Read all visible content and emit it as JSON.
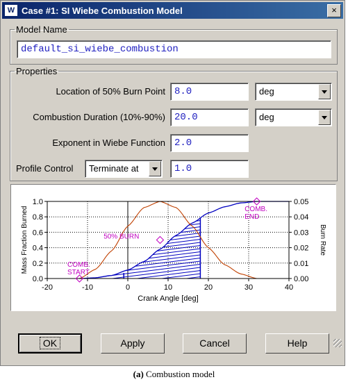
{
  "window": {
    "app_icon_text": "W",
    "title": "Case #1: SI Wiebe Combustion Model",
    "close_label": "×"
  },
  "model_name": {
    "legend": "Model Name",
    "value": "default_si_wiebe_combustion"
  },
  "properties": {
    "legend": "Properties",
    "burn_point": {
      "label": "Location of 50% Burn Point",
      "value": "8.0",
      "unit": "deg"
    },
    "duration": {
      "label": "Combustion Duration (10%-90%)",
      "value": "20.0",
      "unit": "deg"
    },
    "exponent": {
      "label": "Exponent in Wiebe Function",
      "value": "2.0"
    },
    "profile": {
      "label": "Profile Control",
      "mode": "Terminate at",
      "value": "1.0"
    }
  },
  "chart_data": {
    "type": "line",
    "xlabel": "Crank Angle  [deg]",
    "ylabel_left": "Mass Fraction Burned",
    "ylabel_right": "Burn Rate",
    "xlim": [
      -20,
      40
    ],
    "ylim_left": [
      0,
      1.0
    ],
    "ylim_right": [
      0,
      0.05
    ],
    "x_ticks": [
      "-20",
      "-10",
      "0",
      "10",
      "20",
      "30",
      "40"
    ],
    "y_left_ticks": [
      "0.0",
      "0.2",
      "0.4",
      "0.6",
      "0.8",
      "1.0"
    ],
    "y_right_ticks": [
      "0.00",
      "0.01",
      "0.02",
      "0.03",
      "0.04",
      "0.05"
    ],
    "grid": true,
    "series": [
      {
        "values": [
          [
            -12,
            0.0
          ],
          [
            -8,
            0.01
          ],
          [
            -4,
            0.04
          ],
          [
            0,
            0.11
          ],
          [
            4,
            0.22
          ],
          [
            8,
            0.38
          ],
          [
            12,
            0.56
          ],
          [
            16,
            0.72
          ],
          [
            20,
            0.85
          ],
          [
            24,
            0.93
          ],
          [
            28,
            0.98
          ],
          [
            32,
            1.0
          ]
        ]
      },
      {
        "values": [
          [
            -12,
            0.0
          ],
          [
            -8,
            0.006
          ],
          [
            -4,
            0.018
          ],
          [
            0,
            0.034
          ],
          [
            4,
            0.046
          ],
          [
            8,
            0.05
          ],
          [
            12,
            0.046
          ],
          [
            16,
            0.034
          ],
          [
            20,
            0.02
          ],
          [
            24,
            0.009
          ],
          [
            28,
            0.003
          ],
          [
            32,
            0.0
          ]
        ]
      }
    ],
    "annotations": [
      {
        "text": "COMB.",
        "text2": "START",
        "x": -12,
        "y": 0.0
      },
      {
        "text": "50% BURN",
        "x": 8,
        "y": 0.5
      },
      {
        "text": "COMB.",
        "text2": "END",
        "x": 32,
        "y": 1.0
      }
    ],
    "colors": {
      "burned": "#0000c0",
      "rate": "#c04000",
      "marker": "#c000c0"
    }
  },
  "buttons": {
    "ok": "OK",
    "apply": "Apply",
    "cancel": "Cancel",
    "help": "Help"
  },
  "caption": {
    "prefix": "(a)",
    "text": " Combustion model"
  }
}
